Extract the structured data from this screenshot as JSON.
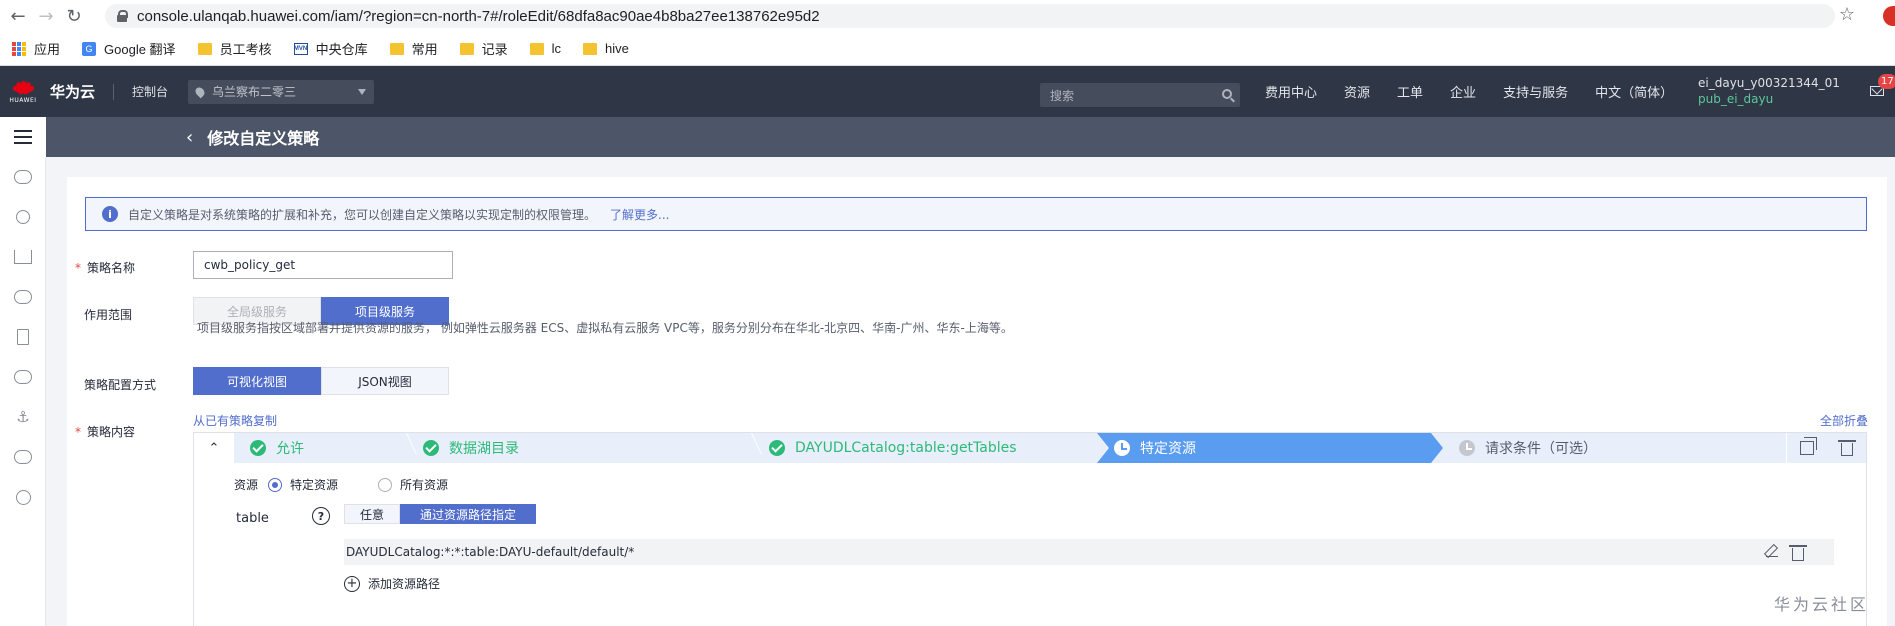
{
  "browser": {
    "url": "console.ulanqab.huawei.com/iam/?region=cn-north-7#/roleEdit/68dfa8ac90ae4b8ba27ee138762e95d2",
    "bookmarks": [
      "应用",
      "Google 翻译",
      "员工考核",
      "中央仓库",
      "常用",
      "记录",
      "lc",
      "hive"
    ]
  },
  "topnav": {
    "logo_word": "HUAWEI",
    "brand": "华为云",
    "console": "控制台",
    "region": "乌兰察布二零三",
    "search_placeholder": "搜索",
    "links": [
      "费用中心",
      "资源",
      "工单",
      "企业",
      "支持与服务",
      "中文（简体）"
    ],
    "user_id": "ei_dayu_y00321344_01",
    "user_sub": "pub_ei_dayu",
    "mail_badge": "17"
  },
  "subheader": {
    "title": "修改自定义策略"
  },
  "info": {
    "text": "自定义策略是对系统策略的扩展和补充，您可以创建自定义策略以实现定制的权限管理。",
    "link": "了解更多..."
  },
  "form": {
    "name_label": "策略名称",
    "name_value": "cwb_policy_get",
    "scope_label": "作用范围",
    "scope_options": [
      "全局级服务",
      "项目级服务"
    ],
    "scope_hint": "项目级服务指按区域部署并提供资源的服务， 例如弹性云服务器 ECS、虚拟私有云服务 VPC等，服务分别分布在华北-北京四、华南-广州、华东-上海等。",
    "mode_label": "策略配置方式",
    "mode_options": [
      "可视化视图",
      "JSON视图"
    ],
    "content_label": "策略内容",
    "copy_link": "从已有策略复制",
    "collapse_all": "全部折叠"
  },
  "steps": [
    {
      "label": "允许",
      "state": "done"
    },
    {
      "label": "数据湖目录",
      "state": "done"
    },
    {
      "label": "DAYUDLCatalog:table:getTables",
      "state": "done"
    },
    {
      "label": "特定资源",
      "state": "active"
    },
    {
      "label": "请求条件（可选）",
      "state": "pending"
    }
  ],
  "resource": {
    "label": "资源",
    "options": [
      "特定资源",
      "所有资源"
    ],
    "table_label": "table",
    "help": "?",
    "path_modes": [
      "任意",
      "通过资源路径指定"
    ],
    "path_value": "DAYUDLCatalog:*:*:table:DAYU-default/default/*",
    "add_path": "添加资源路径"
  },
  "watermark": "华为云社区",
  "colors": {
    "accent": "#526ecc",
    "success": "#2dba78",
    "active_step": "#5a9cf0",
    "nav_bg": "#2f3747"
  }
}
